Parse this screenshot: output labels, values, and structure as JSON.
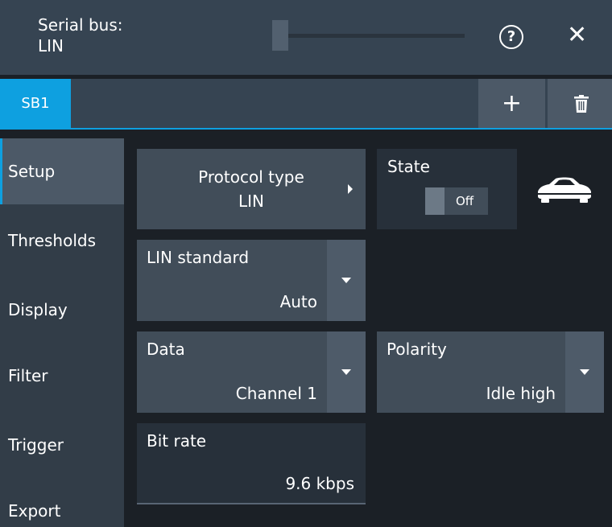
{
  "titlebar": {
    "title_line1": "Serial bus:",
    "title_line2": "LIN",
    "help_glyph": "?",
    "close_glyph": "✕"
  },
  "tabs": {
    "active": "SB1",
    "add_glyph": "+"
  },
  "sidebar": {
    "items": [
      {
        "label": "Setup",
        "active": true
      },
      {
        "label": "Thresholds",
        "active": false
      },
      {
        "label": "Display",
        "active": false
      },
      {
        "label": "Filter",
        "active": false
      },
      {
        "label": "Trigger",
        "active": false
      },
      {
        "label": "Export",
        "active": false
      }
    ]
  },
  "setup": {
    "protocol_type": {
      "label": "Protocol type",
      "value": "LIN"
    },
    "state": {
      "label": "State",
      "toggle": "Off"
    },
    "lin_standard": {
      "label": "LIN standard",
      "value": "Auto"
    },
    "data": {
      "label": "Data",
      "value": "Channel 1"
    },
    "polarity": {
      "label": "Polarity",
      "value": "Idle high"
    },
    "bit_rate": {
      "label": "Bit rate",
      "value": "9.6 kbps"
    }
  },
  "colors": {
    "accent": "#0ea0e0",
    "header_bg": "#364452",
    "panel_bg": "#1b2026",
    "button_bg": "#414d59"
  },
  "icons": {
    "help": "help-circle-icon",
    "close": "close-icon",
    "add": "plus-icon",
    "delete": "trash-icon",
    "car": "car-icon"
  }
}
